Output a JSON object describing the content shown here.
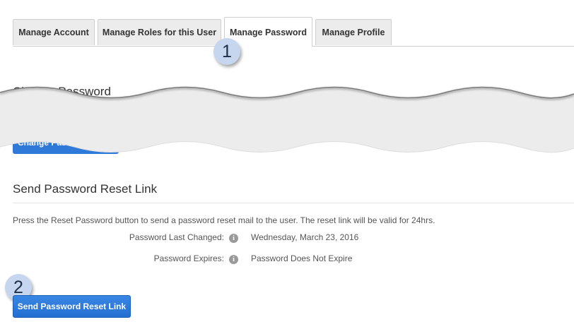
{
  "tabs": [
    {
      "label": "Manage Account",
      "active": false
    },
    {
      "label": "Manage Roles for this User",
      "active": false
    },
    {
      "label": "Manage Password",
      "active": true
    },
    {
      "label": "Manage Profile",
      "active": false
    }
  ],
  "callouts": [
    "1",
    "2"
  ],
  "change_password": {
    "title": "Change Password",
    "button_label": "Change Password"
  },
  "reset": {
    "title": "Send Password Reset Link",
    "description": "Press the Reset Password button to send a password reset mail to the user. The reset link will be valid for 24hrs.",
    "fields": [
      {
        "label": "Password Last Changed:",
        "value": "Wednesday, March 23, 2016"
      },
      {
        "label": "Password Expires:",
        "value": "Password Does Not Expire"
      }
    ],
    "button_label": "Send Password Reset Link"
  },
  "colors": {
    "primary_button": "#2f79d8",
    "callout_fill": "#c5d6ee"
  }
}
